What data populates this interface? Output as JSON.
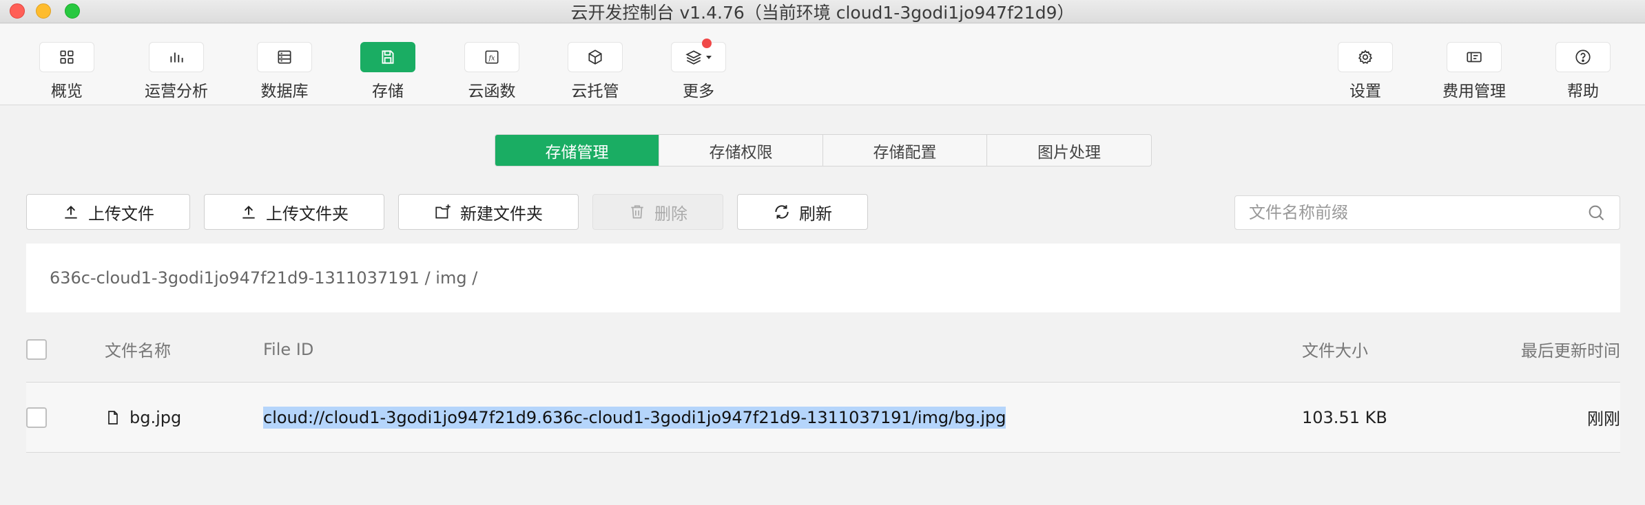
{
  "window": {
    "title": "云开发控制台 v1.4.76（当前环境 cloud1-3godi1jo947f21d9）"
  },
  "toolbar": {
    "left_items": [
      {
        "label": "概览",
        "icon": "grid-icon"
      },
      {
        "label": "运营分析",
        "icon": "bar-chart-icon"
      },
      {
        "label": "数据库",
        "icon": "database-icon"
      },
      {
        "label": "存储",
        "icon": "save-icon",
        "active": true
      },
      {
        "label": "云函数",
        "icon": "function-icon"
      },
      {
        "label": "云托管",
        "icon": "cube-icon"
      },
      {
        "label": "更多",
        "icon": "layers-icon",
        "badge": true
      }
    ],
    "right_items": [
      {
        "label": "设置",
        "icon": "gear-icon"
      },
      {
        "label": "费用管理",
        "icon": "billing-icon"
      },
      {
        "label": "帮助",
        "icon": "help-icon"
      }
    ]
  },
  "tabs": [
    "存储管理",
    "存储权限",
    "存储配置",
    "图片处理"
  ],
  "actions": {
    "upload_file": "上传文件",
    "upload_folder": "上传文件夹",
    "new_folder": "新建文件夹",
    "delete": "删除",
    "refresh": "刷新"
  },
  "search": {
    "placeholder": "文件名称前缀",
    "value": ""
  },
  "breadcrumb": "636c-cloud1-3godi1jo947f21d9-1311037191 / img /",
  "table": {
    "headers": {
      "name": "文件名称",
      "file_id": "File ID",
      "size": "文件大小",
      "updated": "最后更新时间"
    },
    "rows": [
      {
        "name": "bg.jpg",
        "file_id": "cloud://cloud1-3godi1jo947f21d9.636c-cloud1-3godi1jo947f21d9-1311037191/img/bg.jpg",
        "size": "103.51 KB",
        "updated": "刚刚"
      }
    ]
  },
  "colors": {
    "accent": "#1aad63",
    "badge": "#f04848",
    "selection": "#b5d5fb"
  }
}
